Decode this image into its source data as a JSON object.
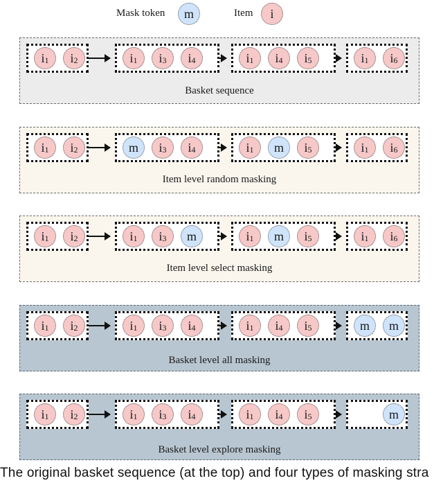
{
  "legend": {
    "mask_label": "Mask token",
    "mask_symbol": "m",
    "item_label": "Item",
    "item_symbol": "i"
  },
  "colors": {
    "item_fill": "#f6c8c8",
    "mask_fill": "#cfe4fb",
    "panel_gray": "#ececec",
    "panel_cream": "#faf6ee",
    "panel_slate": "#b8c6d1"
  },
  "panels": [
    {
      "title": "Basket sequence",
      "style": "gray",
      "baskets": [
        [
          {
            "t": "item",
            "s": "1"
          },
          {
            "t": "item",
            "s": "2"
          }
        ],
        [
          {
            "t": "item",
            "s": "1"
          },
          {
            "t": "item",
            "s": "3"
          },
          {
            "t": "item",
            "s": "4"
          }
        ],
        [
          {
            "t": "item",
            "s": "1"
          },
          {
            "t": "item",
            "s": "4"
          },
          {
            "t": "item",
            "s": "5"
          }
        ],
        [
          {
            "t": "item",
            "s": "1"
          },
          {
            "t": "item",
            "s": "6"
          }
        ]
      ]
    },
    {
      "title": "Item level random masking",
      "style": "cream",
      "baskets": [
        [
          {
            "t": "item",
            "s": "1"
          },
          {
            "t": "item",
            "s": "2"
          }
        ],
        [
          {
            "t": "mask"
          },
          {
            "t": "item",
            "s": "3"
          },
          {
            "t": "item",
            "s": "4"
          }
        ],
        [
          {
            "t": "item",
            "s": "1"
          },
          {
            "t": "mask"
          },
          {
            "t": "item",
            "s": "5"
          }
        ],
        [
          {
            "t": "item",
            "s": "1"
          },
          {
            "t": "item",
            "s": "6"
          }
        ]
      ]
    },
    {
      "title": "Item level select masking",
      "style": "cream",
      "baskets": [
        [
          {
            "t": "item",
            "s": "1"
          },
          {
            "t": "item",
            "s": "2"
          }
        ],
        [
          {
            "t": "item",
            "s": "1"
          },
          {
            "t": "item",
            "s": "3"
          },
          {
            "t": "mask"
          }
        ],
        [
          {
            "t": "item",
            "s": "1"
          },
          {
            "t": "mask"
          },
          {
            "t": "item",
            "s": "5"
          }
        ],
        [
          {
            "t": "item",
            "s": "1"
          },
          {
            "t": "item",
            "s": "6"
          }
        ]
      ]
    },
    {
      "title": "Basket level all masking",
      "style": "slate",
      "baskets": [
        [
          {
            "t": "item",
            "s": "1"
          },
          {
            "t": "item",
            "s": "2"
          }
        ],
        [
          {
            "t": "item",
            "s": "1"
          },
          {
            "t": "item",
            "s": "3"
          },
          {
            "t": "item",
            "s": "4"
          }
        ],
        [
          {
            "t": "item",
            "s": "1"
          },
          {
            "t": "item",
            "s": "4"
          },
          {
            "t": "item",
            "s": "5"
          }
        ],
        [
          {
            "t": "mask"
          },
          {
            "t": "mask"
          }
        ]
      ]
    },
    {
      "title": "Basket level explore masking",
      "style": "slate",
      "baskets": [
        [
          {
            "t": "item",
            "s": "1"
          },
          {
            "t": "item",
            "s": "2"
          }
        ],
        [
          {
            "t": "item",
            "s": "1"
          },
          {
            "t": "item",
            "s": "3"
          },
          {
            "t": "item",
            "s": "4"
          }
        ],
        [
          {
            "t": "item",
            "s": "1"
          },
          {
            "t": "item",
            "s": "4"
          },
          {
            "t": "item",
            "s": "5"
          }
        ],
        [
          {
            "t": "empty"
          },
          {
            "t": "mask"
          }
        ]
      ]
    }
  ],
  "caption": "The original basket sequence (at the top) and four types of masking stra"
}
